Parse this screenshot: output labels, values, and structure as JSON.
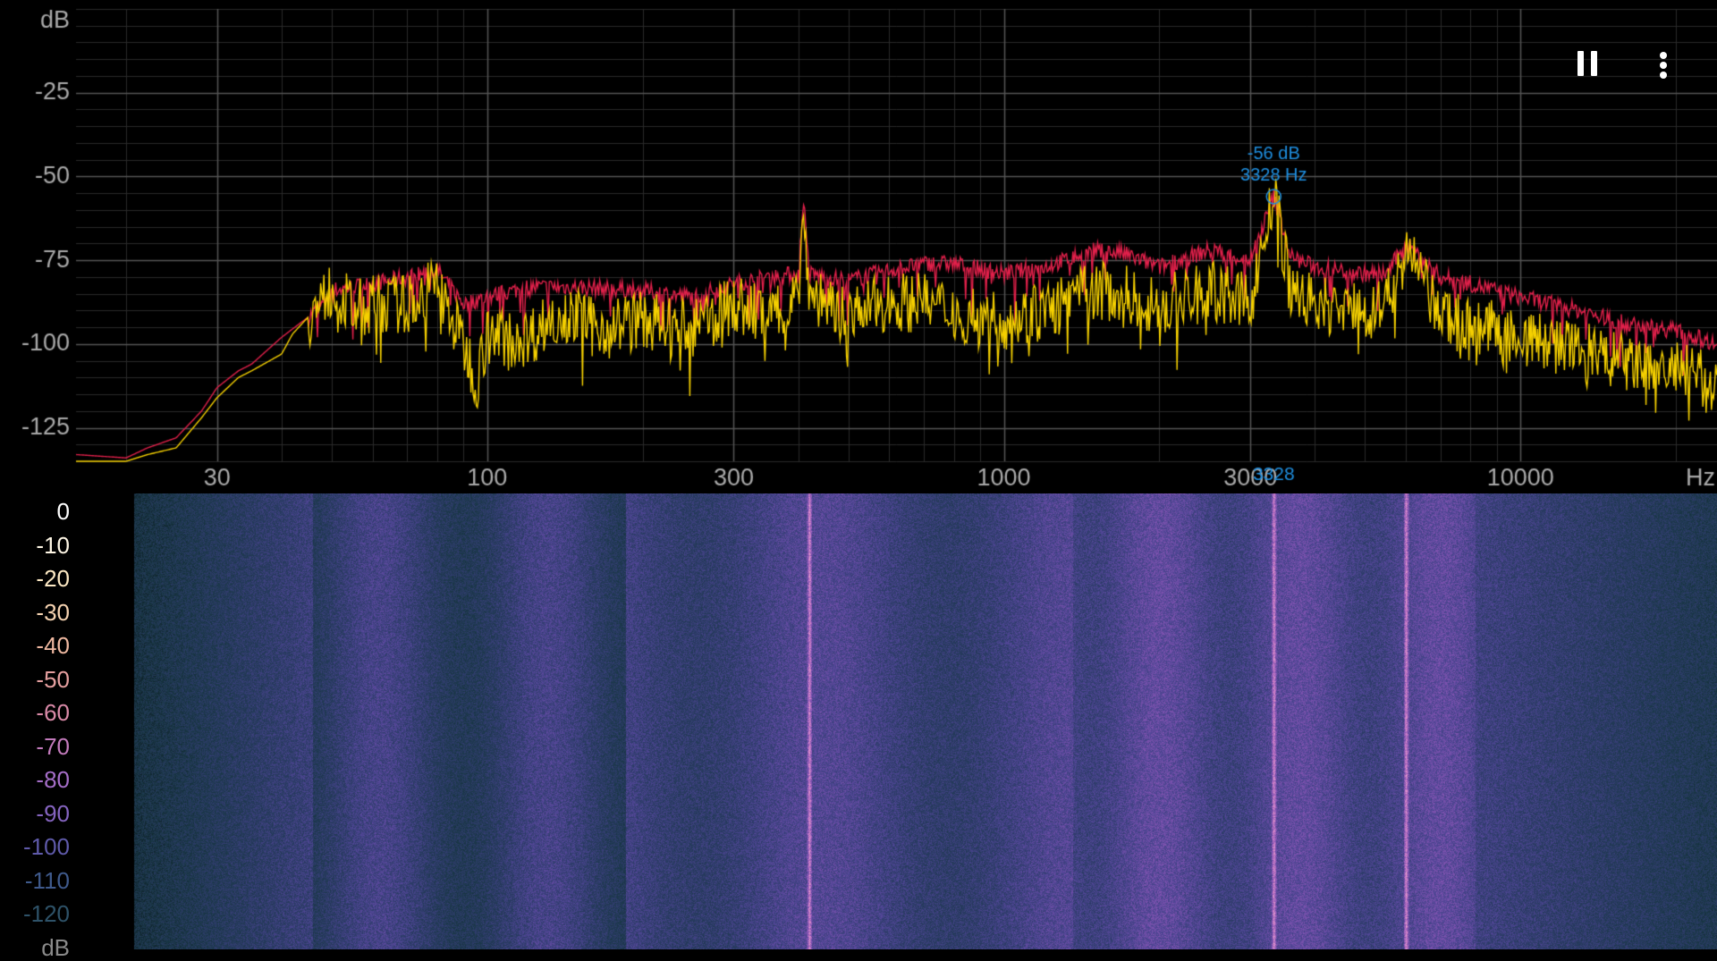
{
  "spectrum": {
    "y_unit": "dB",
    "x_unit": "Hz",
    "y_ticks": [
      "-25",
      "-50",
      "-75",
      "-100",
      "-125"
    ],
    "y_tick_values": [
      -25,
      -50,
      -75,
      -100,
      -125
    ],
    "x_ticks": [
      "30",
      "100",
      "300",
      "1000",
      "3000",
      "10000"
    ],
    "x_tick_values": [
      30,
      100,
      300,
      1000,
      3000,
      10000
    ],
    "peak": {
      "db_label": "-56 dB",
      "hz_label": "3328 Hz",
      "axis_label": "3328",
      "freq": 3328,
      "db": -56
    },
    "colors": {
      "current": "#f5d000",
      "peak_hold": "#e0204a",
      "grid": "#444444",
      "cursor": "#1f8fe0",
      "label": "#aaaaaa"
    }
  },
  "chart_data": {
    "type": "line",
    "xlabel": "Hz",
    "ylabel": "dB",
    "xscale": "log",
    "xlim": [
      16,
      24000
    ],
    "ylim": [
      -135,
      0
    ],
    "grid": true,
    "series": [
      {
        "color": "#f5d000",
        "x": [
          16,
          20,
          22,
          25,
          28,
          30,
          33,
          35,
          40,
          42,
          45,
          48,
          50,
          55,
          60,
          70,
          80,
          85,
          90,
          95,
          100,
          120,
          140,
          160,
          200,
          250,
          300,
          350,
          400,
          410,
          420,
          450,
          500,
          600,
          700,
          800,
          1000,
          1200,
          1500,
          1700,
          2000,
          2500,
          3000,
          3328,
          3600,
          4000,
          5000,
          5500,
          6000,
          7000,
          8000,
          10000,
          13000,
          16000,
          20000,
          24000
        ],
        "y": [
          -135,
          -135,
          -133,
          -131,
          -122,
          -116,
          -110,
          -108,
          -103,
          -97,
          -92,
          -88,
          -83,
          -90,
          -88,
          -88,
          -82,
          -92,
          -100,
          -110,
          -98,
          -98,
          -90,
          -95,
          -93,
          -96,
          -88,
          -92,
          -85,
          -60,
          -85,
          -87,
          -92,
          -87,
          -88,
          -90,
          -93,
          -90,
          -84,
          -85,
          -89,
          -84,
          -88,
          -56,
          -84,
          -88,
          -90,
          -88,
          -72,
          -92,
          -94,
          -98,
          -102,
          -106,
          -108,
          -112
        ]
      },
      {
        "color": "#e0204a",
        "x": [
          16,
          20,
          22,
          25,
          28,
          30,
          33,
          35,
          40,
          45,
          48,
          50,
          60,
          70,
          80,
          85,
          90,
          100,
          120,
          150,
          200,
          250,
          300,
          350,
          400,
          410,
          420,
          450,
          500,
          600,
          700,
          800,
          1000,
          1200,
          1500,
          1700,
          2000,
          2500,
          3000,
          3328,
          3600,
          4000,
          5000,
          5500,
          6000,
          7000,
          8000,
          10000,
          13000,
          16000,
          20000,
          24000
        ],
        "y": [
          -133,
          -134,
          -131,
          -128,
          -120,
          -113,
          -108,
          -106,
          -98,
          -92,
          -88,
          -84,
          -82,
          -80,
          -78,
          -83,
          -88,
          -86,
          -83,
          -83,
          -84,
          -86,
          -82,
          -80,
          -79,
          -58,
          -79,
          -80,
          -81,
          -78,
          -76,
          -76,
          -79,
          -77,
          -72,
          -73,
          -77,
          -72,
          -75,
          -56,
          -74,
          -77,
          -79,
          -79,
          -70,
          -80,
          -82,
          -86,
          -90,
          -94,
          -96,
          -100
        ]
      }
    ]
  },
  "spectrogram": {
    "scale_labels": [
      "0",
      "-10",
      "-20",
      "-30",
      "-40",
      "-50",
      "-60",
      "-70",
      "-80",
      "-90",
      "-100",
      "-110",
      "-120",
      "dB"
    ],
    "scale_colors": [
      "#ffffff",
      "#fff7e6",
      "#fde9c4",
      "#f6d3b1",
      "#f0b9a1",
      "#e6a0a0",
      "#da8aa8",
      "#c47bbd",
      "#a56ec8",
      "#8564c0",
      "#5f5aaa",
      "#3f5a8c",
      "#2e5268",
      "#8a8a8a"
    ],
    "lines_hz": [
      420,
      3328,
      6000
    ]
  }
}
